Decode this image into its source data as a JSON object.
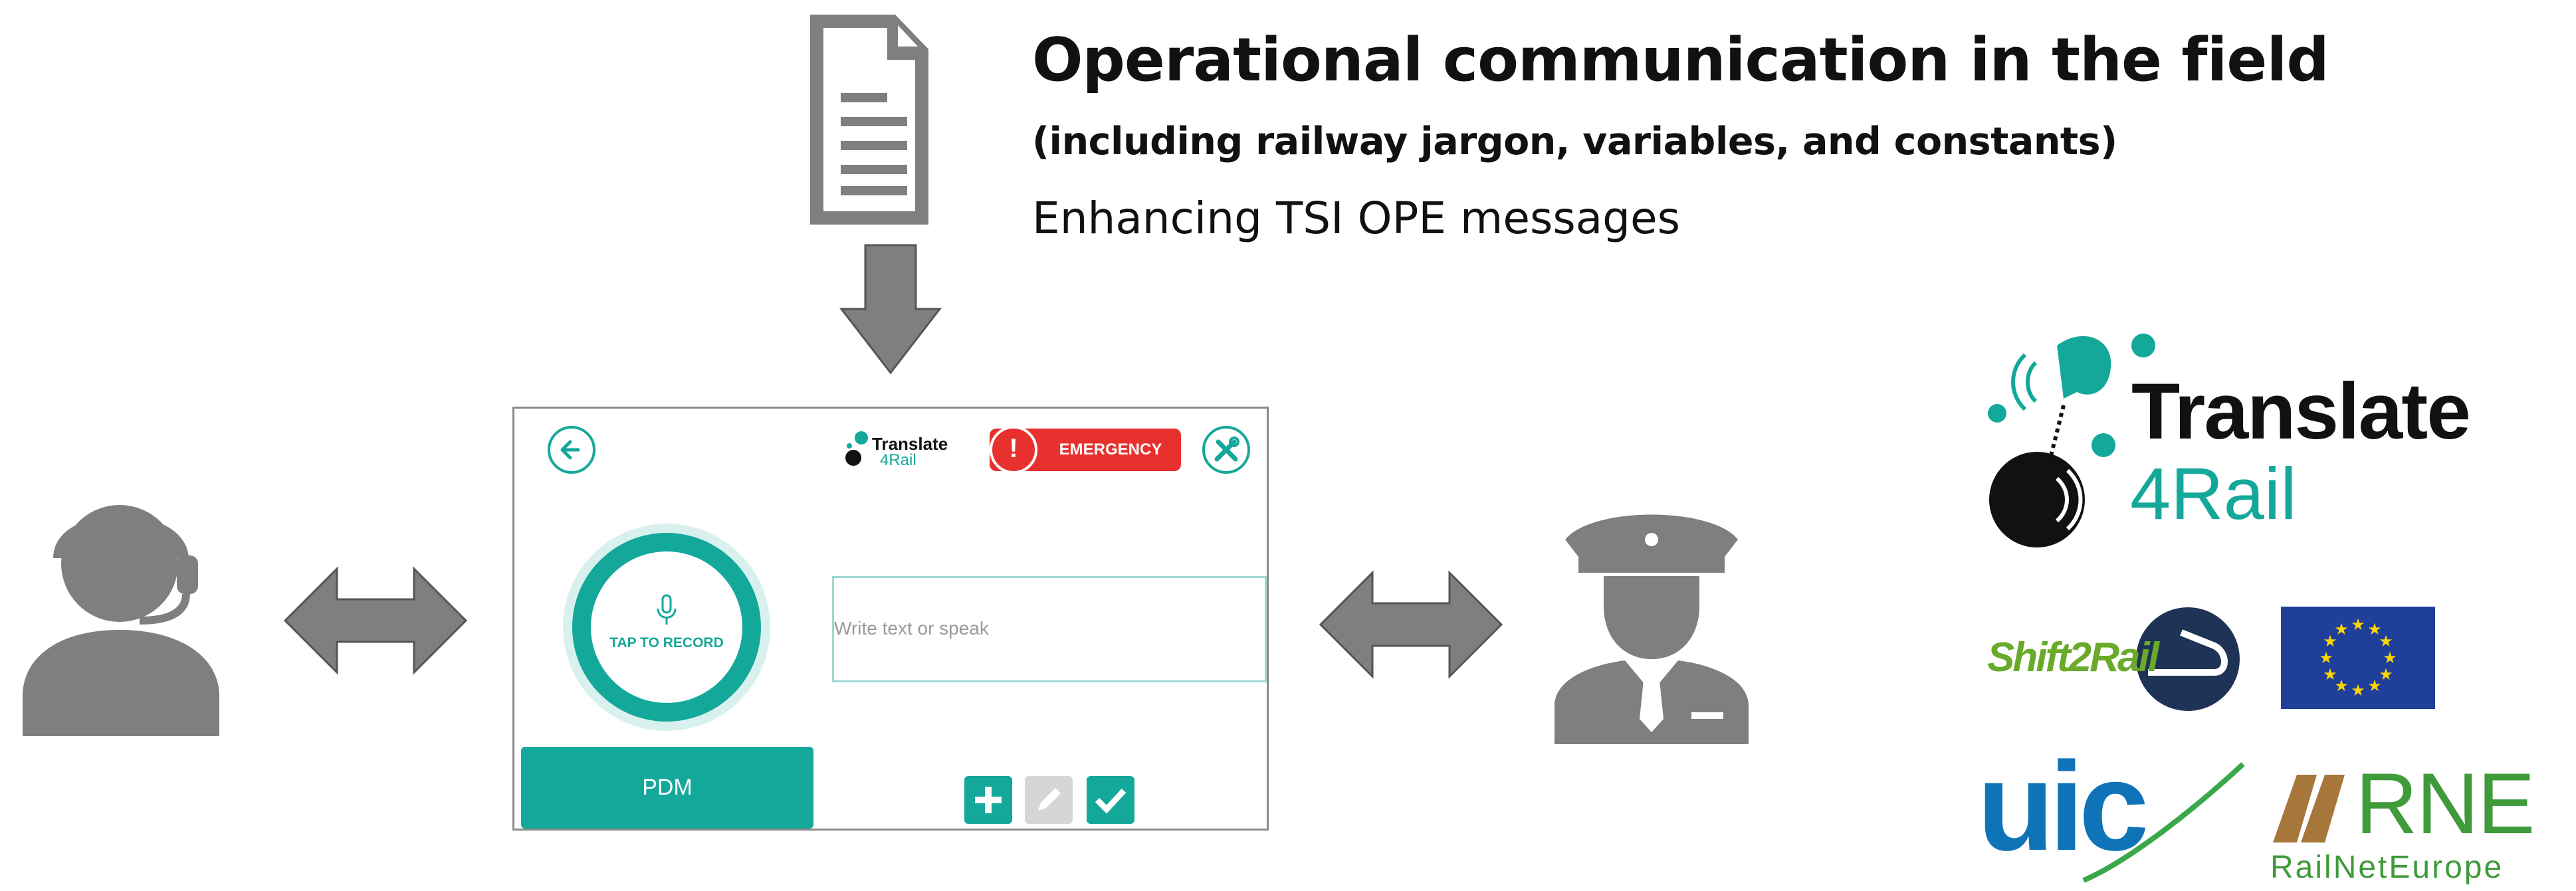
{
  "header": {
    "title": "Operational communication in the field",
    "subtitle": "(including railway jargon, variables, and constants)",
    "tagline": "Enhancing TSI OPE messages"
  },
  "app": {
    "logo_line1": "Translate",
    "logo_line2": "4Rail",
    "emergency_label": "EMERGENCY",
    "record_label": "TAP TO RECORD",
    "input_placeholder": "Write text or speak",
    "pdm_label": "PDM",
    "accent_color": "#14a89a",
    "emergency_color": "#e8312f"
  },
  "logos": {
    "translate_line1": "Translate",
    "translate_line2": "4Rail",
    "shift2rail": "Shift2Rail",
    "uic": "uic",
    "rne": "RNE",
    "rne_sub": "RailNetEurope"
  },
  "icons": [
    "document-icon",
    "arrow-down-icon",
    "operator-headset-icon",
    "double-arrow-icon",
    "conductor-icon",
    "back-arrow-icon",
    "wrench-icon",
    "microphone-icon",
    "plus-icon",
    "pencil-icon",
    "check-icon",
    "eu-flag-icon"
  ]
}
